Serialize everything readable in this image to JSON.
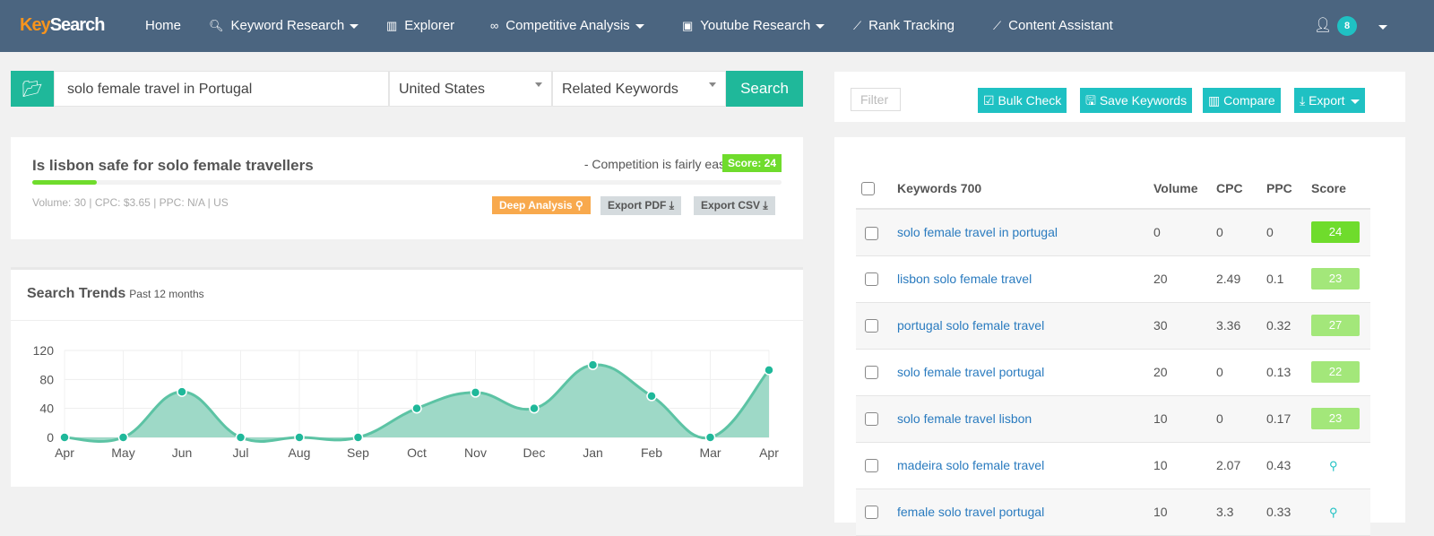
{
  "nav": {
    "logo_a": "Key",
    "logo_b": "Search",
    "items": [
      {
        "label": "Home",
        "icon": ""
      },
      {
        "label": "Keyword Research",
        "icon": "search-icon",
        "caret": true
      },
      {
        "label": "Explorer",
        "icon": "bar-chart-icon"
      },
      {
        "label": "Competitive Analysis",
        "icon": "link-icon",
        "caret": true
      },
      {
        "label": "Youtube Research",
        "icon": "save-icon",
        "caret": true
      },
      {
        "label": "Rank Tracking",
        "icon": "line-chart-icon"
      },
      {
        "label": "Content Assistant",
        "icon": "line-chart-icon"
      }
    ],
    "notifications": "8"
  },
  "search": {
    "query": "solo female travel in Portugal",
    "country": "United States",
    "mode": "Related Keywords",
    "button": "Search"
  },
  "summary": {
    "keyword": "Is lisbon safe for solo female travellers",
    "competition": "- Competition is fairly easy",
    "score": "Score: 24",
    "score_value": 24,
    "meta": "Volume: 30 | CPC: $3.65 | PPC: N/A | US",
    "deep": "Deep Analysis",
    "pdf": "Export PDF",
    "csv": "Export CSV",
    "colors": {
      "green": "#6fdc2c",
      "orange": "#f8a94d"
    }
  },
  "trends": {
    "title": "Search Trends",
    "subtitle": "Past 12 months"
  },
  "chart_data": {
    "type": "area",
    "categories": [
      "Apr",
      "May",
      "Jun",
      "Jul",
      "Aug",
      "Sep",
      "Oct",
      "Nov",
      "Dec",
      "Jan",
      "Feb",
      "Mar",
      "Apr"
    ],
    "values": [
      0,
      0,
      63,
      0,
      0,
      0,
      40,
      62,
      40,
      100,
      57,
      0,
      93
    ],
    "ylim": [
      0,
      120
    ],
    "yticks": [
      0,
      40,
      80,
      120
    ],
    "grid": true,
    "color": "#1fb89a"
  },
  "toolbar": {
    "filter": "Filter",
    "bulk": "Bulk Check",
    "save": "Save Keywords",
    "compare": "Compare",
    "export": "Export"
  },
  "table": {
    "headers": [
      "Keywords 700",
      "Volume",
      "CPC",
      "PPC",
      "Score"
    ],
    "rows": [
      {
        "kw": "solo female travel in portugal",
        "vol": "0",
        "cpc": "0",
        "ppc": "0",
        "score": "24",
        "color": "#6fdc2c"
      },
      {
        "kw": "lisbon solo female travel",
        "vol": "20",
        "cpc": "2.49",
        "ppc": "0.1",
        "score": "23",
        "color": "#a3e77a"
      },
      {
        "kw": "portugal solo female travel",
        "vol": "30",
        "cpc": "3.36",
        "ppc": "0.32",
        "score": "27",
        "color": "#a3e77a"
      },
      {
        "kw": "solo female travel portugal",
        "vol": "20",
        "cpc": "0",
        "ppc": "0.13",
        "score": "22",
        "color": "#a3e77a"
      },
      {
        "kw": "solo female travel lisbon",
        "vol": "10",
        "cpc": "0",
        "ppc": "0.17",
        "score": "23",
        "color": "#a3e77a"
      },
      {
        "kw": "madeira solo female travel",
        "vol": "10",
        "cpc": "2.07",
        "ppc": "0.43",
        "score": ""
      },
      {
        "kw": "female solo travel portugal",
        "vol": "10",
        "cpc": "3.3",
        "ppc": "0.33",
        "score": ""
      }
    ]
  }
}
